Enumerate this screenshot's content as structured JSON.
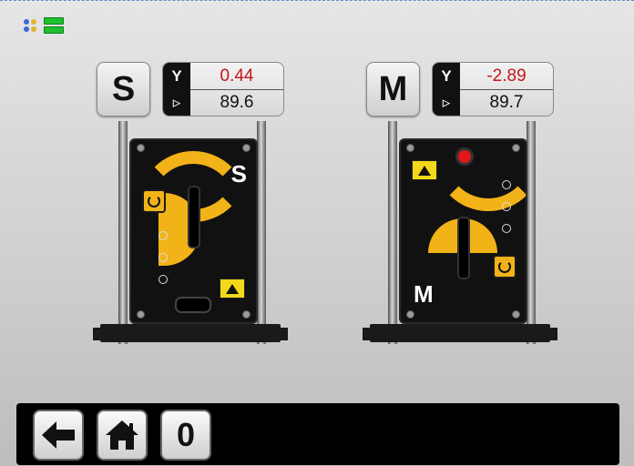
{
  "status": {
    "bluetooth_icon": "bluetooth-icon",
    "battery_icon": "battery-icon",
    "colors": {
      "bluetooth": "#3b66d6",
      "battery": "#1fbf2f"
    }
  },
  "units": [
    {
      "label": "S",
      "y_symbol": "Y",
      "angle_symbol": "▹",
      "y_value": "0.44",
      "angle_value": "89.6",
      "face_letter": "S"
    },
    {
      "label": "M",
      "y_symbol": "Y",
      "angle_symbol": "▹",
      "y_value": "-2.89",
      "angle_value": "89.7",
      "face_letter": "M"
    }
  ],
  "toolbar": {
    "back_icon": "arrow-left-icon",
    "home_icon": "home-icon",
    "counter_label": "0"
  },
  "colors": {
    "accent": "#f2b318",
    "value_red": "#c4161c",
    "warning": "#f2d81a"
  }
}
